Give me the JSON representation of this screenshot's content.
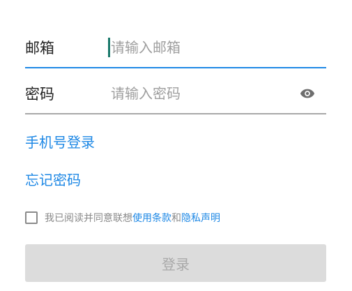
{
  "email": {
    "label": "邮箱",
    "placeholder": "请输入邮箱",
    "value": ""
  },
  "password": {
    "label": "密码",
    "placeholder": "请输入密码",
    "value": "",
    "toggle_icon": "eye-icon"
  },
  "links": {
    "phone_login": "手机号登录",
    "forgot_password": "忘记密码"
  },
  "agreement": {
    "checked": false,
    "prefix": "我已阅读并同意联想",
    "terms": "使用条款",
    "and": "和",
    "privacy": "隐私声明"
  },
  "login_button": {
    "label": "登录",
    "enabled": false
  },
  "colors": {
    "accent": "#1e88e5",
    "caret": "#1b7a6c",
    "disabled_button_bg": "#dcdcdc",
    "disabled_button_text": "#a9a9a9"
  }
}
